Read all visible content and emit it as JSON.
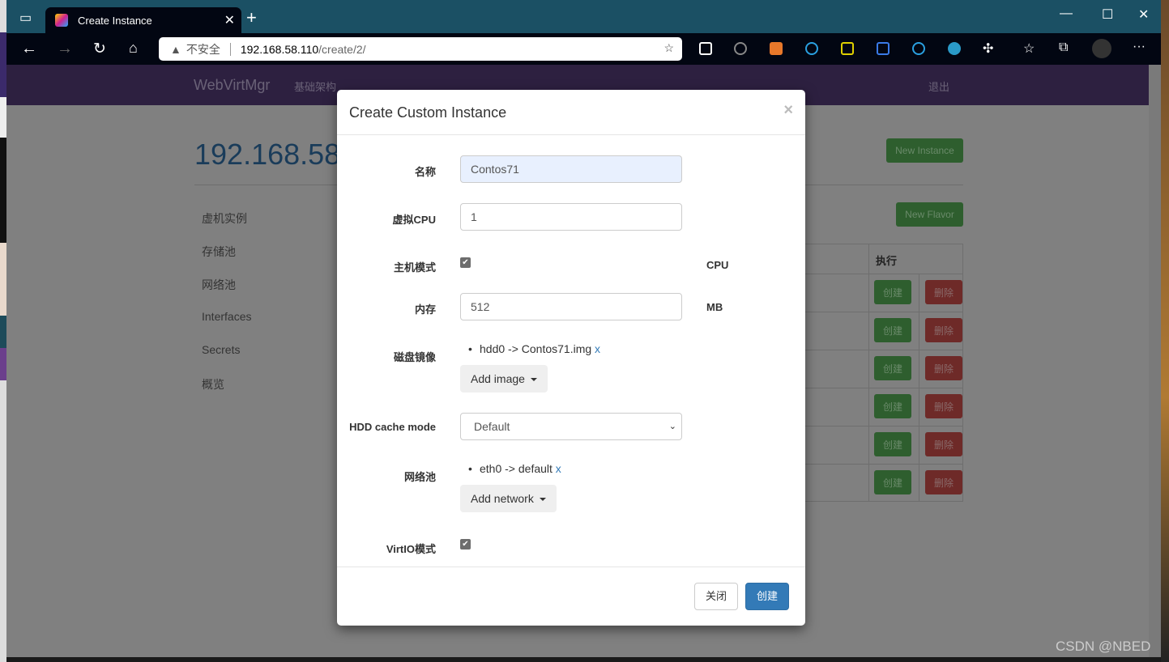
{
  "browser": {
    "tab_title": "Create Instance",
    "security_label": "不安全",
    "url_host": "192.168.58.110",
    "url_path": "/create/2/"
  },
  "nav": {
    "brand": "WebVirtMgr",
    "infrastructure": "基础架构",
    "logout": "退出"
  },
  "page": {
    "title": "192.168.58.",
    "new_instance": "New Instance",
    "new_flavor": "New Flavor",
    "sidebar": [
      "虚机实例",
      "存储池",
      "网络池",
      "Interfaces",
      "Secrets",
      "概览"
    ],
    "table": {
      "action_header": "执行",
      "create_label": "创建",
      "delete_label": "删除",
      "rows": 6
    }
  },
  "modal": {
    "title": "Create Custom Instance",
    "close_x": "×",
    "name_label": "名称",
    "name_value": "Contos71",
    "vcpu_label": "虚拟CPU",
    "vcpu_value": "1",
    "host_mode_label": "主机模式",
    "host_mode_checked": true,
    "host_mode_unit": "CPU",
    "memory_label": "内存",
    "memory_value": "512",
    "memory_unit": "MB",
    "disk_label": "磁盘镜像",
    "disk_item": "hdd0 -> Contos71.img",
    "remove_x": "x",
    "add_image": "Add image",
    "cache_label": "HDD cache mode",
    "cache_value": "Default",
    "network_label": "网络池",
    "network_item": "eth0 -> default",
    "add_network": "Add network",
    "virtio_label": "VirtIO模式",
    "virtio_checked": true,
    "close_button": "关闭",
    "create_button": "创建"
  },
  "watermark": "CSDN @NBED"
}
